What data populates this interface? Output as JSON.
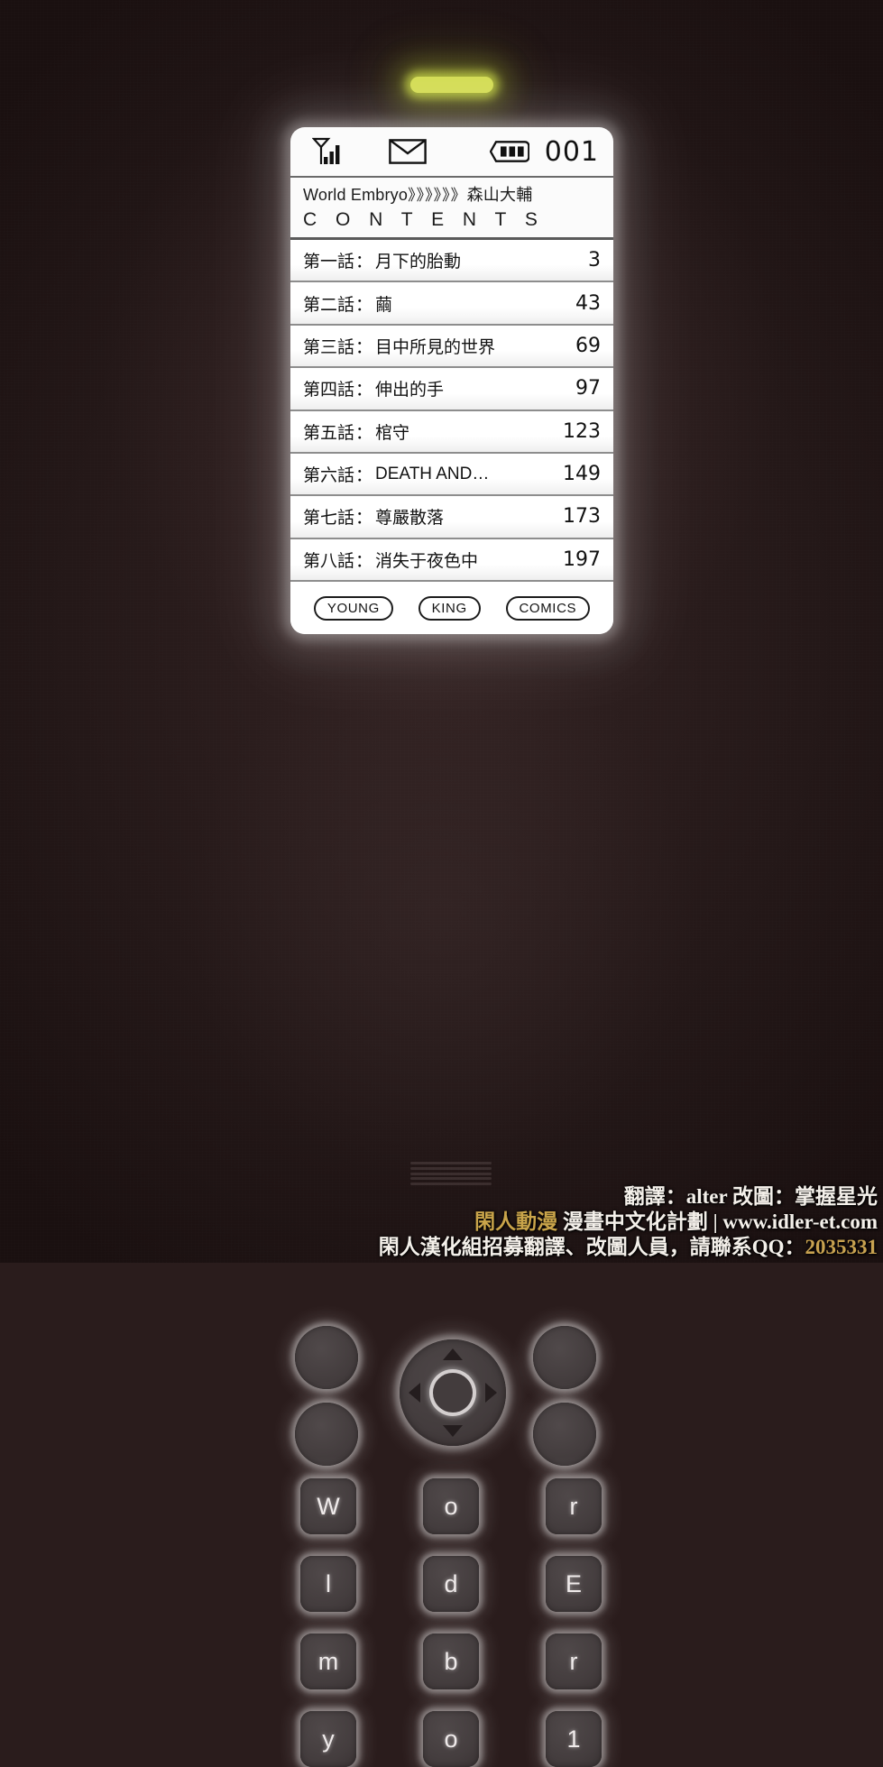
{
  "device": {
    "led_light": "indicator-led",
    "status_bar": {
      "signal_icon": "signal-antenna-icon",
      "mail_icon": "mail-envelope-icon",
      "battery_icon": "battery-full-icon",
      "page_number": "001"
    },
    "title": {
      "series": "World Embryo",
      "chevrons": "》》》》》》",
      "author": "森山大輔",
      "contents_label": "C O N T E N T S"
    },
    "toc": [
      {
        "chapter": "第一話",
        "sep": "：",
        "title": "月下的胎動",
        "page": "3"
      },
      {
        "chapter": "第二話",
        "sep": "：",
        "title": "繭",
        "page": "43"
      },
      {
        "chapter": "第三話",
        "sep": "：",
        "title": "目中所見的世界",
        "page": "69"
      },
      {
        "chapter": "第四話",
        "sep": "：",
        "title": "伸出的手",
        "page": "97"
      },
      {
        "chapter": "第五話",
        "sep": "：",
        "title": "棺守",
        "page": "123"
      },
      {
        "chapter": "第六話",
        "sep": "：",
        "title": "DEATH AND…",
        "page": "149"
      },
      {
        "chapter": "第七話",
        "sep": "：",
        "title": "尊嚴散落",
        "page": "173"
      },
      {
        "chapter": "第八話",
        "sep": "：",
        "title": "消失于夜色中",
        "page": "197"
      }
    ],
    "tags": [
      "YOUNG",
      "KING",
      "COMICS"
    ],
    "keypad": {
      "soft_buttons": [
        "left-upper",
        "left-lower",
        "right-upper",
        "right-lower"
      ],
      "dpad": {
        "up": "dpad-up-arrow",
        "down": "dpad-down-arrow",
        "left": "dpad-left-arrow",
        "right": "dpad-right-arrow",
        "center": "dpad-center-select"
      },
      "keys": [
        [
          "W",
          "o",
          "r"
        ],
        [
          "l",
          "d",
          "E"
        ],
        [
          "m",
          "b",
          "r"
        ],
        [
          "y",
          "o",
          "1"
        ]
      ]
    }
  },
  "credits": {
    "line1_prefix": "翻譯：",
    "line1_translator": "alter",
    "line1_mid": " 改圖：",
    "line1_editor": "掌握星光",
    "line2_group": "閑人動漫",
    "line2_rest": " 漫畫中文化計劃 | www.idler-et.com",
    "line3_text": "閑人漢化組招募翻譯、改圖人員，請聯系QQ：",
    "line3_qq": "2035331"
  },
  "colors": {
    "background": "#2a1c1c",
    "screen": "#fbfbfb",
    "led": "#d4dd55",
    "key_face": "#443d3e",
    "glow": "#ffffff",
    "credit_gold": "#c9a44a"
  }
}
